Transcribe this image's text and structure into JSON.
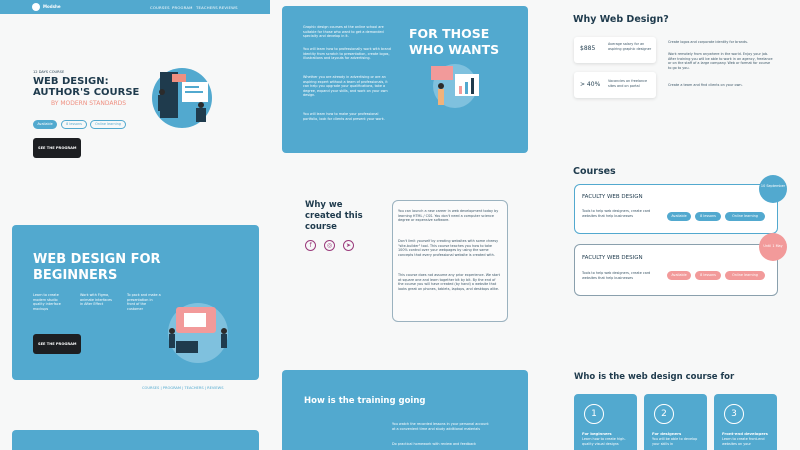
{
  "header": {
    "logo_text": "Modshe",
    "nav": [
      "COURSES",
      "PROGRAM",
      "TEACHERS",
      "REVIEWS"
    ]
  },
  "hero": {
    "eyebrow": "12 DAYS COURSE",
    "title_line1": "WEB DESIGN:",
    "title_line2": "AUTHOR'S COURSE",
    "subtitle": "BY MODERN STANDARDS",
    "tags": [
      "Available",
      "8 lessons",
      "Online learning"
    ],
    "cta": "SEE THE PROGRAM"
  },
  "beginners": {
    "title_line1": "WEB DESIGN FOR",
    "title_line2": "BEGINNERS",
    "features": [
      "Learn to create modern studio quality interface mockups",
      "Work with Figma, animate interfaces in After Effect",
      "To pack and make a presentation in front of the customer"
    ],
    "cta": "SEE THE PROGRAM",
    "footer_nav": "COURSES | PROGRAM | TEACHERS | REVIEWS"
  },
  "for_those": {
    "title_line1": "FOR THOSE",
    "title_line2": "WHO WANTS",
    "paragraphs": [
      "Graphic design courses at the online school are suitable for those who want to get a demanded specialty and develop in it.",
      "You will learn how to professionally work with brand identity from scratch to presentation, create logos, illustrations and layouts for advertising.",
      "Whether you are already in advertising or are an aspiring expert without a team of professionals, it can help you upgrade your qualifications, take a degree, expand your skills, and work on your own design.",
      "You will learn how to make your professional portfolio, look for clients and present your work."
    ]
  },
  "why_created": {
    "title_line1": "Why we",
    "title_line2": "created this",
    "title_line3": "course",
    "social_icons": [
      "f",
      "◎",
      "➤"
    ],
    "paragraphs": [
      "You can launch a new career in web development today by learning HTML / CSS. You don't need a computer science degree or expensive software.",
      "Don't limit yourself by creating websites with some cheesy \"site-builder\" tool. This course teaches you how to take 100% control over your webpages by using the same concepts that every professional website is created with.",
      "This course does not assume any prior experience. We start at square one and learn together bit by bit. By the end of the course you will have created (by hand) a website that looks great on phones, tablets, laptops, and desktops alike."
    ]
  },
  "training": {
    "title": "How is the training going",
    "lines": [
      "You watch the recorded lessons in your personal account at a convenient time and study additional materials",
      "Do practical homework with review and feedback"
    ]
  },
  "why_web": {
    "title": "Why Web Design?",
    "stats": [
      {
        "value": "$885",
        "text": "Average salary for an aspiring graphic designer"
      },
      {
        "value": "> 40%",
        "text": "Vacancies on freelance sites and on portal"
      }
    ],
    "paragraphs": [
      "Create logos and corporate identity for brands.",
      "Work remotely from anywhere in the world. Enjoy your job. After training you will be able to work in an agency, freelance or on the staff of a large company. Web or format for course to go to you.",
      "Create a team and find clients on your own."
    ]
  },
  "courses": {
    "title": "Courses",
    "items": [
      {
        "name": "FACULTY WEB DESIGN",
        "desc": "Tools to help web designers, create card websites that help businesses",
        "badge": "10 September",
        "tags": [
          "Available",
          "8 lessons",
          "Online learning"
        ],
        "accent": "#52a9cf"
      },
      {
        "name": "FACULTY WEB DESIGN",
        "desc": "Tools to help web designers, create card websites that help businesses",
        "badge": "Until 1 May",
        "tags": [
          "Available",
          "8 lessons",
          "Online learning"
        ],
        "accent": "#f29a9a"
      }
    ]
  },
  "who_for": {
    "title": "Who is the web design course for",
    "cards": [
      {
        "num": "1",
        "title": "For beginners",
        "text": "Learn how to create high-quality visual designs"
      },
      {
        "num": "2",
        "title": "For designers",
        "text": "You will be able to develop your skills in"
      },
      {
        "num": "3",
        "title": "Front-end developers",
        "text": "Learn to create front-end websites on your"
      }
    ]
  },
  "colors": {
    "primary": "#52a9cf",
    "dark": "#1d1f22",
    "coral": "#f29a9a",
    "navy": "#1f3b4d"
  }
}
